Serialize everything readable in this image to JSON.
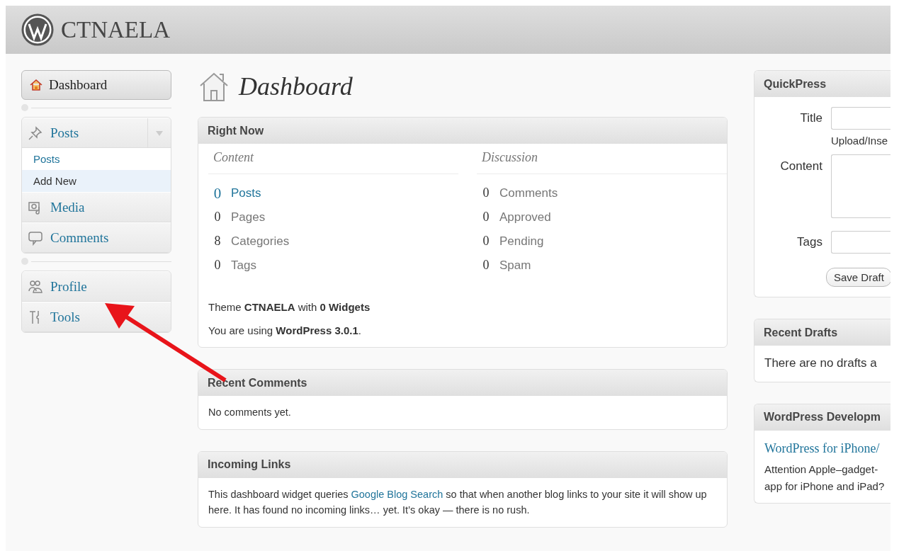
{
  "header": {
    "site_title": "CTNAELA"
  },
  "sidebar": {
    "dashboard": {
      "label": "Dashboard",
      "selected": true
    },
    "groups": [
      {
        "items": [
          {
            "label": "Posts",
            "kind": "pin",
            "expanded": true,
            "children": [
              {
                "label": "Posts",
                "selected": false
              },
              {
                "label": "Add New",
                "selected": true
              }
            ]
          },
          {
            "label": "Media",
            "kind": "media"
          },
          {
            "label": "Comments",
            "kind": "comment"
          }
        ]
      },
      {
        "items": [
          {
            "label": "Profile",
            "kind": "users"
          },
          {
            "label": "Tools",
            "kind": "tools"
          }
        ]
      }
    ]
  },
  "page_title": "Dashboard",
  "right_now": {
    "title": "Right Now",
    "columns": [
      {
        "heading": "Content",
        "rows": [
          {
            "count": "0",
            "label": "Posts",
            "kind": "link"
          },
          {
            "count": "0",
            "label": "Pages",
            "kind": "text"
          },
          {
            "count": "8",
            "label": "Categories",
            "kind": "text"
          },
          {
            "count": "0",
            "label": "Tags",
            "kind": "text"
          }
        ]
      },
      {
        "heading": "Discussion",
        "rows": [
          {
            "count": "0",
            "label": "Comments",
            "kind": "text"
          },
          {
            "count": "0",
            "label": "Approved",
            "kind": "text"
          },
          {
            "count": "0",
            "label": "Pending",
            "kind": "text"
          },
          {
            "count": "0",
            "label": "Spam",
            "kind": "text"
          }
        ]
      }
    ],
    "theme_line": "Theme **CTNAELA** with **0 Widgets**",
    "version_line": "You are using **WordPress 3.0.1**."
  },
  "recent_comments": {
    "title": "Recent Comments",
    "text": "No comments yet."
  },
  "incoming_links": {
    "title": "Incoming Links",
    "before": "This dashboard widget queries",
    "link": "Google Blog Search",
    "after": "so that when another blog links to your site it will show up here. It has found no incoming links… yet. It’s okay — there is no rush."
  },
  "quickpress": {
    "title": "QuickPress",
    "title_label": "Title",
    "upload_label": "Upload/Inse",
    "content_label": "Content",
    "tags_label": "Tags",
    "save_button": "Save Draft"
  },
  "recent_drafts": {
    "title": "Recent Drafts",
    "text": "There are no drafts a"
  },
  "dev_blog": {
    "title": "WordPress Developm",
    "post_title": "WordPress for iPhone/",
    "lines": [
      "Attention Apple–gadget-",
      "app for iPhone and iPad?"
    ]
  }
}
